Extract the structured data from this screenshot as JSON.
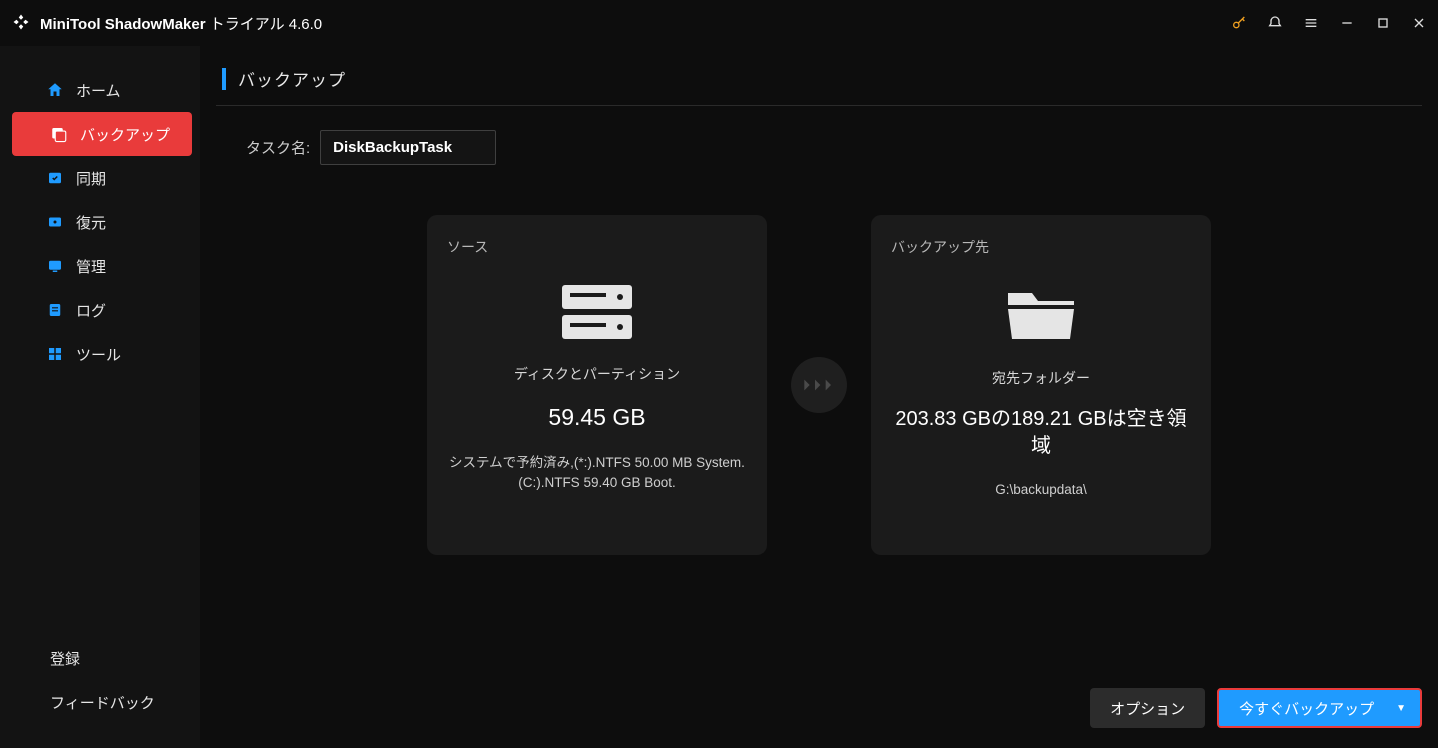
{
  "title": {
    "app": "MiniTool ShadowMaker",
    "edition": "トライアル 4.6.0"
  },
  "nav": {
    "home": "ホーム",
    "backup": "バックアップ",
    "sync": "同期",
    "restore": "復元",
    "manage": "管理",
    "log": "ログ",
    "tools": "ツール"
  },
  "sidebar_bottom": {
    "register": "登録",
    "feedback": "フィードバック"
  },
  "page": {
    "heading": "バックアップ"
  },
  "task": {
    "label": "タスク名:",
    "value": "DiskBackupTask"
  },
  "source": {
    "title": "ソース",
    "type": "ディスクとパーティション",
    "size": "59.45 GB",
    "detail1": "システムで予約済み,(*:).NTFS 50.00 MB System.",
    "detail2": "(C:).NTFS 59.40 GB Boot."
  },
  "destination": {
    "title": "バックアップ先",
    "type": "宛先フォルダー",
    "capacity": "203.83 GBの189.21 GBは空き領域",
    "path": "G:\\backupdata\\"
  },
  "footer": {
    "options": "オプション",
    "backup_now": "今すぐバックアップ"
  }
}
